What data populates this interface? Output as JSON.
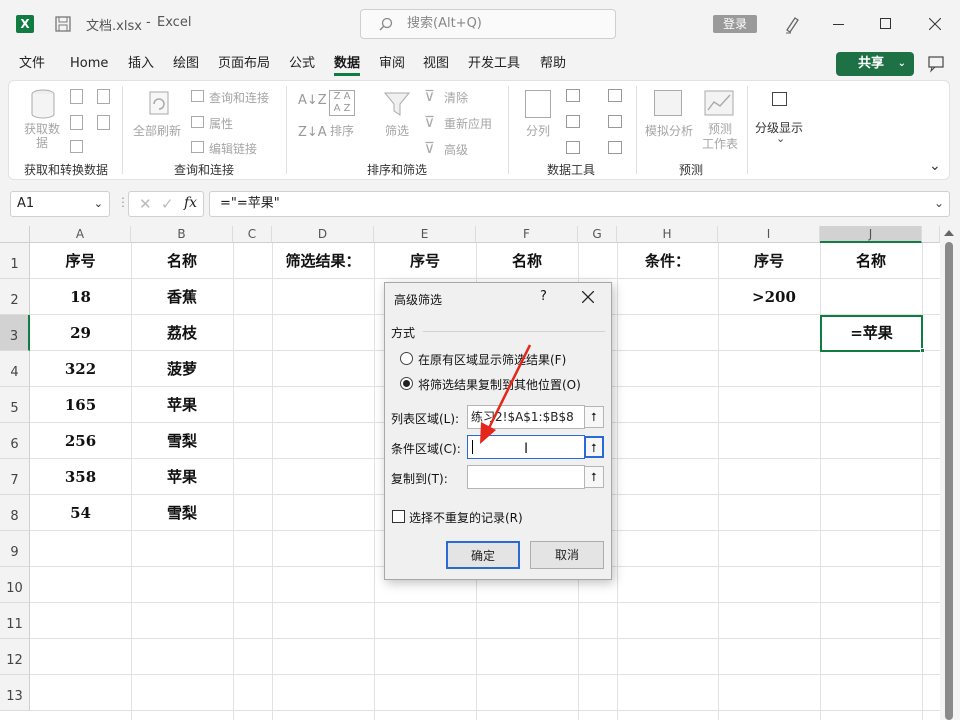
{
  "titlebar": {
    "filename": "文档.xlsx",
    "separator": "-",
    "app": "Excel",
    "search_placeholder": "搜索(Alt+Q)",
    "login": "登录",
    "icons": [
      "excel-icon",
      "save-icon",
      "search-icon",
      "pen-icon",
      "minimize-icon",
      "maximize-icon",
      "close-icon"
    ]
  },
  "menu": {
    "items": [
      "文件",
      "Home",
      "插入",
      "绘图",
      "页面布局",
      "公式",
      "数据",
      "审阅",
      "视图",
      "开发工具",
      "帮助"
    ],
    "active": "数据",
    "share": "共享",
    "accent": "#107c41",
    "share_color": "#1e7145"
  },
  "ribbon": {
    "groups": [
      "获取和转换数据",
      "查询和连接",
      "排序和筛选",
      "数据工具",
      "预测"
    ],
    "get_data": "获取数\n据",
    "refresh_all": "全部刷新",
    "queries": "查询和连接",
    "properties": "属性",
    "edit_links": "编辑链接",
    "sort": "排序",
    "filter": "筛选",
    "clear": "清除",
    "reapply": "重新应用",
    "advanced": "高级",
    "split": "分列",
    "whatif": "模拟分析",
    "forecast": "预测\n工作表",
    "outline": "分级显示"
  },
  "formula_bar": {
    "namebox": "A1",
    "fx": "fx",
    "formula": "=\"=苹果\""
  },
  "grid": {
    "columns": [
      "A",
      "B",
      "C",
      "D",
      "E",
      "F",
      "G",
      "H",
      "I",
      "J"
    ],
    "rows": [
      "1",
      "2",
      "3",
      "4",
      "5",
      "6",
      "7",
      "8",
      "9",
      "10",
      "11",
      "12",
      "13"
    ],
    "row1": {
      "a": "序号",
      "b": "名称",
      "d": "筛选结果：",
      "e": "序号",
      "f": "名称",
      "h": "条件：",
      "i": "序号",
      "j": "名称"
    },
    "data": [
      {
        "a": "18",
        "b": "香蕉"
      },
      {
        "a": "29",
        "b": "荔枝"
      },
      {
        "a": "322",
        "b": "菠萝"
      },
      {
        "a": "165",
        "b": "苹果"
      },
      {
        "a": "256",
        "b": "雪梨"
      },
      {
        "a": "358",
        "b": "苹果"
      },
      {
        "a": "54",
        "b": "雪梨"
      }
    ],
    "i2": ">200",
    "j3": "=苹果"
  },
  "dialog": {
    "title": "高级筛选",
    "help": "?",
    "section": "方式",
    "option1": "在原有区域显示筛选结果(F)",
    "option2": "将筛选结果复制到其他位置(O)",
    "selected_option": 2,
    "list_label": "列表区域(L):",
    "list_value": "练习2!$A$1:$B$8",
    "criteria_label": "条件区域(C):",
    "criteria_value": "",
    "copyto_label": "复制到(T):",
    "copyto_value": "",
    "unique_label": "选择不重复的记录(R)",
    "unique_checked": false,
    "ok": "确定",
    "cancel": "取消"
  }
}
